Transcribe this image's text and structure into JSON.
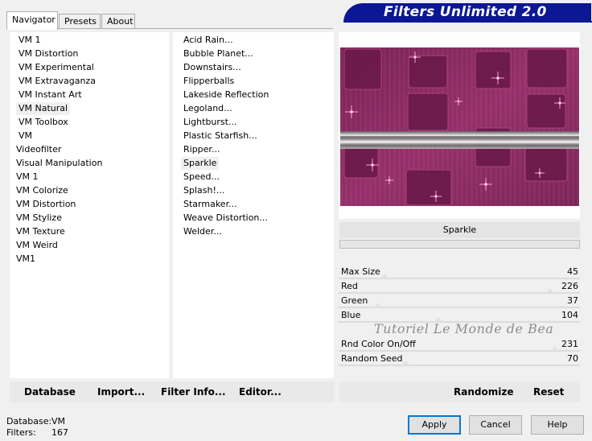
{
  "tabs": [
    "Navigator",
    "Presets",
    "About"
  ],
  "title": "Filters Unlimited 2.0",
  "categories": [
    {
      "label": "VM 1",
      "indent": true
    },
    {
      "label": "VM Distortion",
      "indent": true
    },
    {
      "label": "VM Experimental",
      "indent": true
    },
    {
      "label": "VM Extravaganza",
      "indent": true
    },
    {
      "label": "VM Instant Art",
      "indent": true
    },
    {
      "label": "VM Natural",
      "indent": true,
      "selected": true
    },
    {
      "label": "VM Toolbox",
      "indent": true
    },
    {
      "label": "VM",
      "indent": true
    },
    {
      "label": "Videofilter",
      "indent": false
    },
    {
      "label": "Visual Manipulation",
      "indent": false
    },
    {
      "label": "VM 1",
      "indent": false
    },
    {
      "label": "VM Colorize",
      "indent": false
    },
    {
      "label": "VM Distortion",
      "indent": false
    },
    {
      "label": "VM Stylize",
      "indent": false
    },
    {
      "label": "VM Texture",
      "indent": false
    },
    {
      "label": "VM Weird",
      "indent": false
    },
    {
      "label": "VM1",
      "indent": false
    }
  ],
  "filters": [
    {
      "label": "Acid Rain..."
    },
    {
      "label": "Bubble Planet..."
    },
    {
      "label": "Downstairs..."
    },
    {
      "label": "Flipperballs"
    },
    {
      "label": "Lakeside Reflection"
    },
    {
      "label": "Legoland..."
    },
    {
      "label": "Lightburst..."
    },
    {
      "label": "Plastic Starfish..."
    },
    {
      "label": "Ripper..."
    },
    {
      "label": "Sparkle",
      "selected": true
    },
    {
      "label": "Speed..."
    },
    {
      "label": "Splash!..."
    },
    {
      "label": "Starmaker..."
    },
    {
      "label": "Weave Distortion..."
    },
    {
      "label": "Welder..."
    }
  ],
  "current_filter": "Sparkle",
  "params": [
    {
      "label": "Max Size",
      "value": "45",
      "level": 0.18
    },
    {
      "label": "Red",
      "value": "226",
      "level": 0.89
    },
    {
      "label": "Green",
      "value": "37",
      "level": 0.15
    },
    {
      "label": "Blue",
      "value": "104",
      "level": 0.41
    },
    {
      "label": "",
      "value": "",
      "level": null
    },
    {
      "label": "Rnd Color On/Off",
      "value": "231",
      "level": 0.91
    },
    {
      "label": "Random Seed",
      "value": "70",
      "level": 0.27
    }
  ],
  "watermark": "Tutoriel Le Monde de Bea",
  "left_buttons": {
    "database": "Database",
    "import": "Import...",
    "filter_info": "Filter Info...",
    "editor": "Editor..."
  },
  "right_buttons": {
    "randomize": "Randomize",
    "reset": "Reset"
  },
  "status": {
    "database_label": "Database:",
    "database_value": "VM",
    "filters_label": "Filters:",
    "filters_value": "167"
  },
  "dialog_buttons": {
    "apply": "Apply",
    "cancel": "Cancel",
    "help": "Help"
  },
  "colors": {
    "banner": "#0b1794",
    "preview_base": "#8a2a5f",
    "sparkle": "#ff7ec8"
  }
}
